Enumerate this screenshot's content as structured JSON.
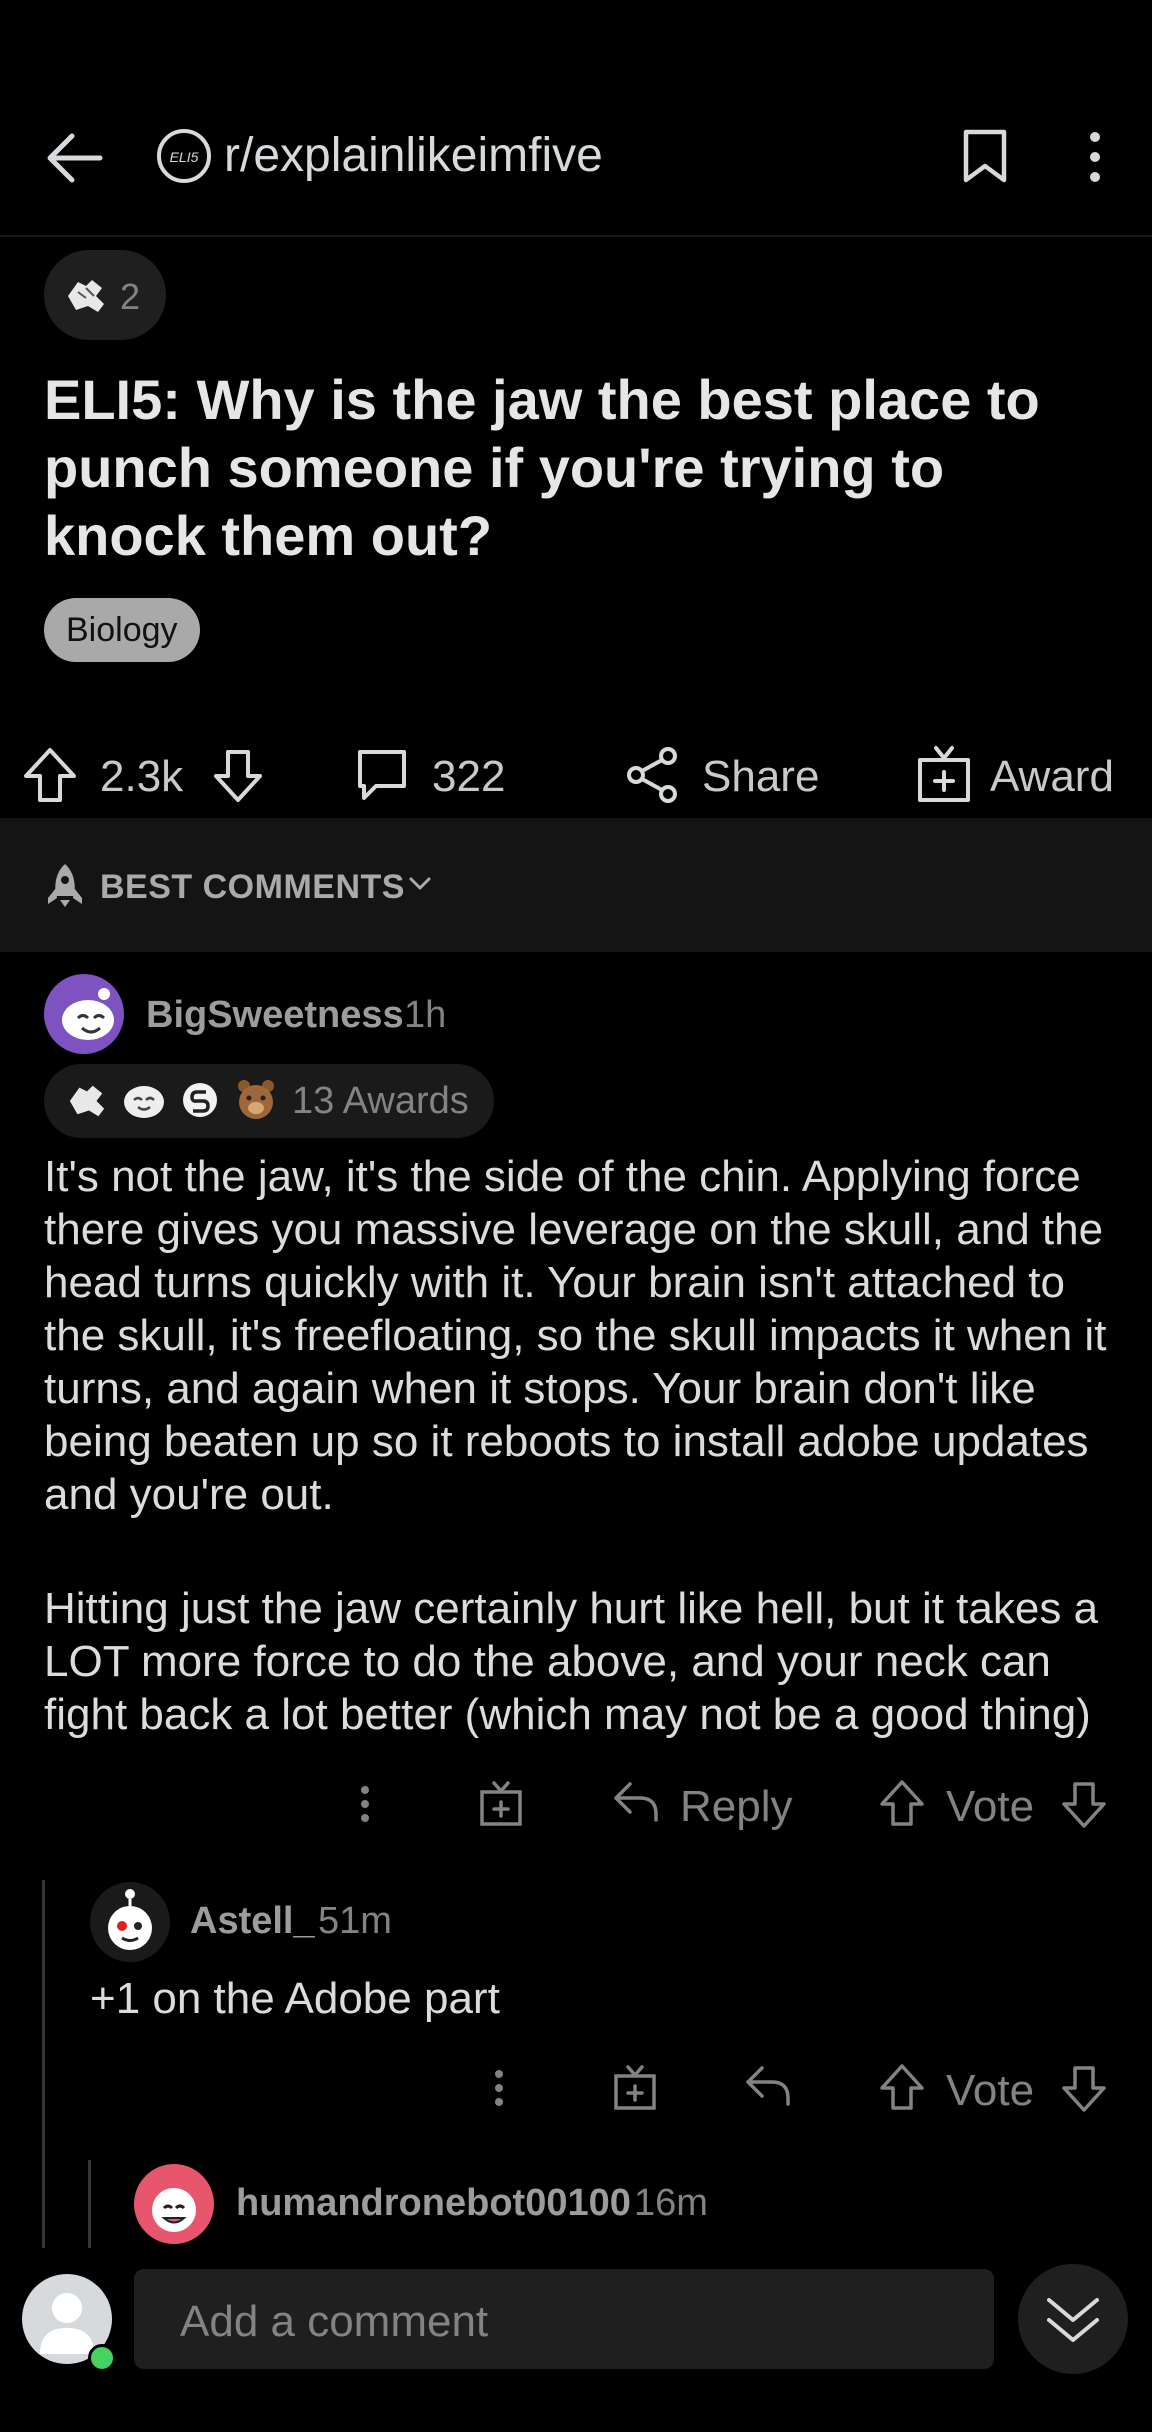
{
  "header": {
    "subreddit": "r/explainlikeimfive",
    "subreddit_icon_text": "ELI5"
  },
  "post": {
    "award_count": "2",
    "title": "ELI5: Why is the jaw the best place to punch someone if you're trying to knock them out?",
    "flair": "Biology",
    "votes": "2.3k",
    "comments": "322",
    "share_label": "Share",
    "award_label": "Award"
  },
  "sort": {
    "label": "BEST COMMENTS"
  },
  "comments": [
    {
      "author": "BigSweetness",
      "time": "1h",
      "awards": "13 Awards",
      "paragraphs": [
        "It's not the jaw, it's the side of the chin.  Applying force there gives you massive leverage on the skull, and the head turns quickly with it.  Your brain isn't attached to the skull, it's freefloating, so the skull impacts it when it turns, and again when it stops.  Your brain don't like being beaten up so it reboots to install adobe updates and you're out.",
        "Hitting just the jaw certainly hurt like hell, but it takes a LOT more force to do the above, and your neck can fight back a lot better (which may not be a good thing)"
      ],
      "reply_label": "Reply",
      "vote_label": "Vote"
    },
    {
      "author": "Astell_",
      "time": "51m",
      "text": "+1 on the Adobe part",
      "vote_label": "Vote"
    },
    {
      "author": "humandronebot00100",
      "time": "16m"
    }
  ],
  "composer": {
    "placeholder": "Add a comment"
  },
  "colors": {
    "background": "#000000",
    "text": "#d7dadc",
    "muted": "#818384",
    "flair_bg": "#a9a9aa",
    "online": "#46d160"
  }
}
